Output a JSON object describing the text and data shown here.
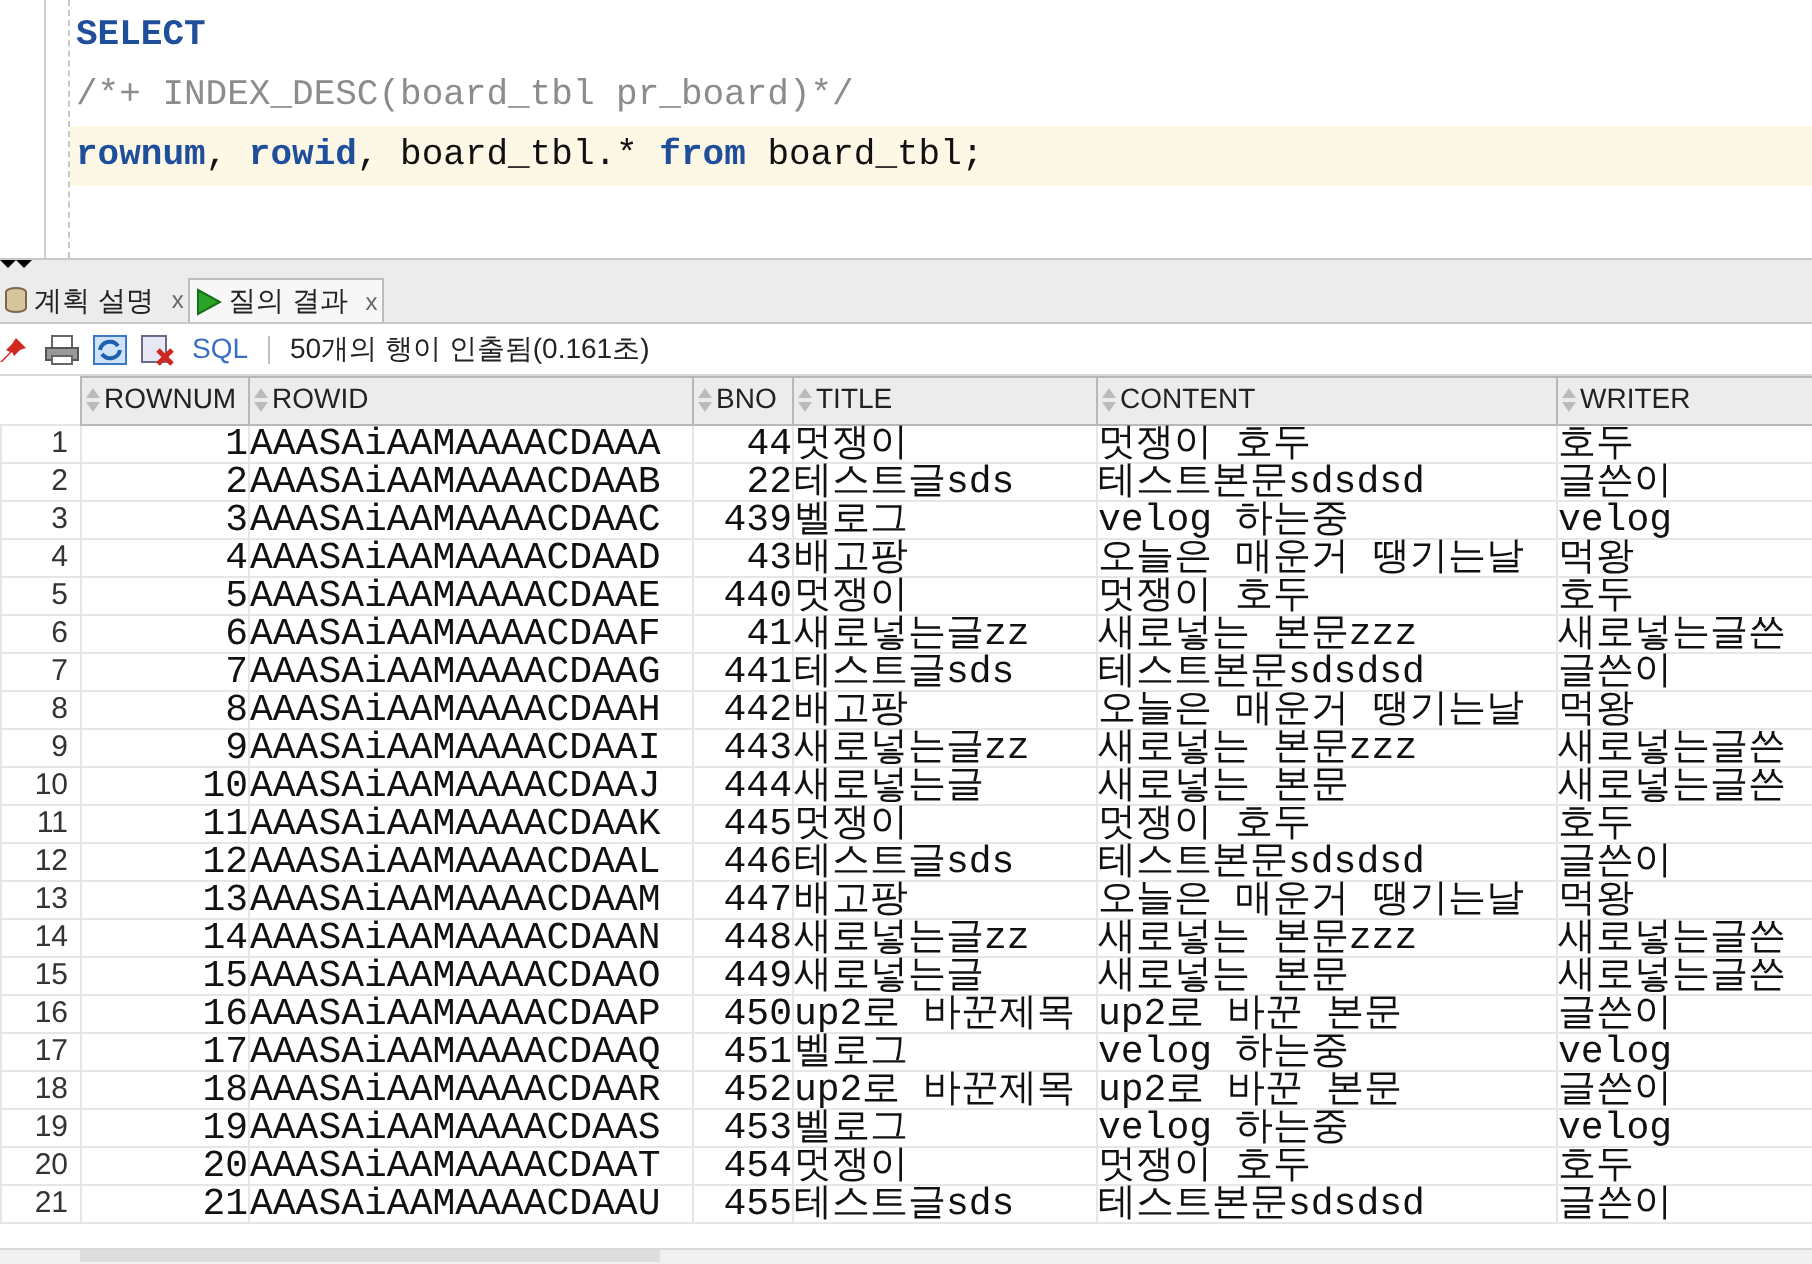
{
  "editor": {
    "lines": [
      {
        "kind": "keyword",
        "text": "SELECT",
        "current": false
      },
      {
        "kind": "comment",
        "text": "/*+ INDEX_DESC(board_tbl pr_board)*/",
        "current": false
      },
      {
        "kind": "mixed",
        "text": "**rownum**, **rowid**, board_tbl.* **from** board_tbl;",
        "current": true
      }
    ]
  },
  "tabs": [
    {
      "label": "계획 설명",
      "close": "x",
      "selected": false
    },
    {
      "label": "질의 결과",
      "close": "x",
      "selected": true
    }
  ],
  "toolbar": {
    "sql_link": "SQL",
    "status": "50개의 행이 인출됨(0.161초)"
  },
  "table": {
    "columns": [
      "ROWNUM",
      "ROWID",
      "BNO",
      "TITLE",
      "CONTENT",
      "WRITER"
    ],
    "rows": [
      {
        "row_number": "1",
        "cells": [
          "1",
          "AAASAiAAMAAAACDAAA",
          "44",
          "멋쟁이",
          "멋쟁이 호두",
          "호두"
        ]
      },
      {
        "row_number": "2",
        "cells": [
          "2",
          "AAASAiAAMAAAACDAAB",
          "22",
          "테스트글sds",
          "테스트본문sdsdsd",
          "글쓴이"
        ]
      },
      {
        "row_number": "3",
        "cells": [
          "3",
          "AAASAiAAMAAAACDAAC",
          "439",
          "벨로그",
          "velog 하는중",
          "velog"
        ]
      },
      {
        "row_number": "4",
        "cells": [
          "4",
          "AAASAiAAMAAAACDAAD",
          "43",
          "배고팡",
          "오늘은 매운거 땡기는날",
          "먹왕"
        ]
      },
      {
        "row_number": "5",
        "cells": [
          "5",
          "AAASAiAAMAAAACDAAE",
          "440",
          "멋쟁이",
          "멋쟁이 호두",
          "호두"
        ]
      },
      {
        "row_number": "6",
        "cells": [
          "6",
          "AAASAiAAMAAAACDAAF",
          "41",
          "새로넣는글zz",
          "새로넣는 본문zzz",
          "새로넣는글쓴"
        ]
      },
      {
        "row_number": "7",
        "cells": [
          "7",
          "AAASAiAAMAAAACDAAG",
          "441",
          "테스트글sds",
          "테스트본문sdsdsd",
          "글쓴이"
        ]
      },
      {
        "row_number": "8",
        "cells": [
          "8",
          "AAASAiAAMAAAACDAAH",
          "442",
          "배고팡",
          "오늘은 매운거 땡기는날",
          "먹왕"
        ]
      },
      {
        "row_number": "9",
        "cells": [
          "9",
          "AAASAiAAMAAAACDAAI",
          "443",
          "새로넣는글zz",
          "새로넣는 본문zzz",
          "새로넣는글쓴"
        ]
      },
      {
        "row_number": "10",
        "cells": [
          "10",
          "AAASAiAAMAAAACDAAJ",
          "444",
          "새로넣는글",
          "새로넣는 본문",
          "새로넣는글쓴"
        ]
      },
      {
        "row_number": "11",
        "cells": [
          "11",
          "AAASAiAAMAAAACDAAK",
          "445",
          "멋쟁이",
          "멋쟁이 호두",
          "호두"
        ]
      },
      {
        "row_number": "12",
        "cells": [
          "12",
          "AAASAiAAMAAAACDAAL",
          "446",
          "테스트글sds",
          "테스트본문sdsdsd",
          "글쓴이"
        ]
      },
      {
        "row_number": "13",
        "cells": [
          "13",
          "AAASAiAAMAAAACDAAM",
          "447",
          "배고팡",
          "오늘은 매운거 땡기는날",
          "먹왕"
        ]
      },
      {
        "row_number": "14",
        "cells": [
          "14",
          "AAASAiAAMAAAACDAAN",
          "448",
          "새로넣는글zz",
          "새로넣는 본문zzz",
          "새로넣는글쓴"
        ]
      },
      {
        "row_number": "15",
        "cells": [
          "15",
          "AAASAiAAMAAAACDAAO",
          "449",
          "새로넣는글",
          "새로넣는 본문",
          "새로넣는글쓴"
        ]
      },
      {
        "row_number": "16",
        "cells": [
          "16",
          "AAASAiAAMAAAACDAAP",
          "450",
          "up2로 바꾼제목",
          "up2로 바꾼 본문",
          "글쓴이"
        ]
      },
      {
        "row_number": "17",
        "cells": [
          "17",
          "AAASAiAAMAAAACDAAQ",
          "451",
          "벨로그",
          "velog 하는중",
          "velog"
        ]
      },
      {
        "row_number": "18",
        "cells": [
          "18",
          "AAASAiAAMAAAACDAAR",
          "452",
          "up2로 바꾼제목",
          "up2로 바꾼 본문",
          "글쓴이"
        ]
      },
      {
        "row_number": "19",
        "cells": [
          "19",
          "AAASAiAAMAAAACDAAS",
          "453",
          "벨로그",
          "velog 하는중",
          "velog"
        ]
      },
      {
        "row_number": "20",
        "cells": [
          "20",
          "AAASAiAAMAAAACDAAT",
          "454",
          "멋쟁이",
          "멋쟁이 호두",
          "호두"
        ]
      },
      {
        "row_number": "21",
        "cells": [
          "21",
          "AAASAiAAMAAAACDAAU",
          "455",
          "테스트글sds",
          "테스트본문sdsdsd",
          "글쓴이"
        ]
      }
    ]
  }
}
